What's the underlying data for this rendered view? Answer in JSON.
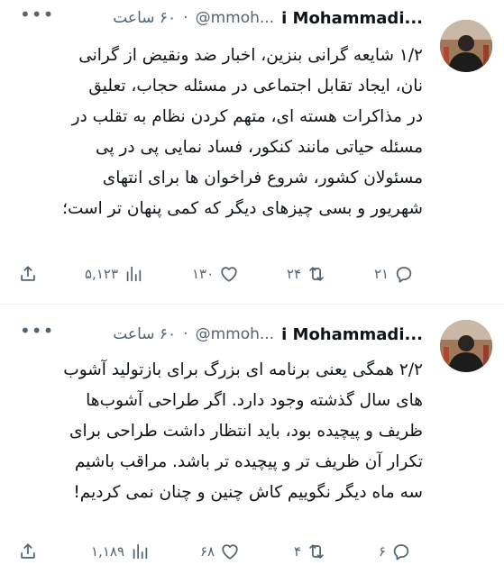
{
  "tweets": [
    {
      "author_name": "i Mohammadi...",
      "handle": "@mmoh...",
      "separator": "·",
      "time": "۶۰ ساعت",
      "more_icon": "more-horizontal-icon",
      "lines": [
        "۱/۲ شایعه گرانی بنزین، اخبار ضد ونقیض از گرانی",
        "نان، ایجاد تقابل اجتماعی در مسئله حجاب، تعلیق",
        "در مذاکرات هسته ای، متهم کردن نظام به تقلب در",
        "مسئله حیاتی مانند کنکور، فساد نمایی پی در پی",
        "مسئولان کشور، شروع فراخوان ها برای انتهای",
        "شهریور و بسی چیزهای دیگر که کمی پنهان تر است؛"
      ],
      "replies": "۲۱",
      "retweets": "۲۴",
      "likes": "۱۳۰",
      "views": "۵,۱۲۳"
    },
    {
      "author_name": "i Mohammadi...",
      "handle": "@mmoh...",
      "separator": "·",
      "time": "۶۰ ساعت",
      "more_icon": "more-horizontal-icon",
      "lines": [
        "۲/۲ همگی یعنی برنامه ای بزرگ برای بازتولید آشوب",
        "های سال گذشته وجود دارد. اگر طراحی آشوب‌ها",
        "ظریف و پیچیده بود، باید انتظار داشت طراحی برای",
        "تکرار آن ظریف تر و پیچیده تر باشد. مراقب باشیم",
        "سه ماه دیگر نگوییم کاش چنین و چنان نمی کردیم!"
      ],
      "replies": "۶",
      "retweets": "۴",
      "likes": "۶۸",
      "views": "۱,۱۸۹"
    }
  ],
  "icons": [
    "reply-icon",
    "retweet-icon",
    "like-icon",
    "views-icon",
    "share-icon"
  ],
  "colors": {
    "text": "#0f1419",
    "secondary": "#536471",
    "divider": "#eff3f4"
  }
}
